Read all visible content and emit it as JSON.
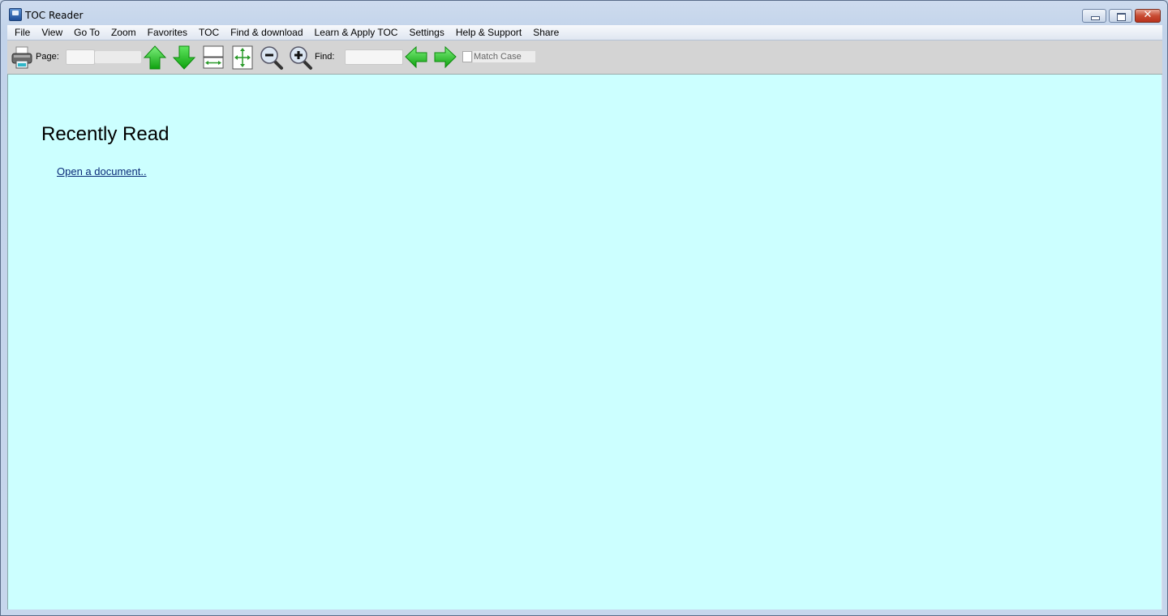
{
  "window": {
    "title": "TOC Reader",
    "controls": {
      "minimize": "minimize",
      "maximize": "maximize",
      "close": "✕"
    }
  },
  "menu": [
    {
      "label": "File"
    },
    {
      "label": "View"
    },
    {
      "label": "Go To"
    },
    {
      "label": "Zoom"
    },
    {
      "label": "Favorites"
    },
    {
      "label": "TOC"
    },
    {
      "label": "Find & download"
    },
    {
      "label": "Learn & Apply TOC"
    },
    {
      "label": "Settings"
    },
    {
      "label": "Help & Support"
    },
    {
      "label": "Share"
    }
  ],
  "toolbar": {
    "page_label": "Page:",
    "page_value": "",
    "page_total": "",
    "find_label": "Find:",
    "find_value": "",
    "match_case_label": "Match Case",
    "match_case_checked": false,
    "icons": [
      "printer-icon",
      "previous-page-icon",
      "next-page-icon",
      "fit-width-icon",
      "fit-page-icon",
      "zoom-out-icon",
      "zoom-in-icon",
      "find-previous-icon",
      "find-next-icon"
    ]
  },
  "content": {
    "heading": "Recently Read",
    "open_link": "Open a document..",
    "background": "#ccffff",
    "link_color": "#0a2a78"
  }
}
